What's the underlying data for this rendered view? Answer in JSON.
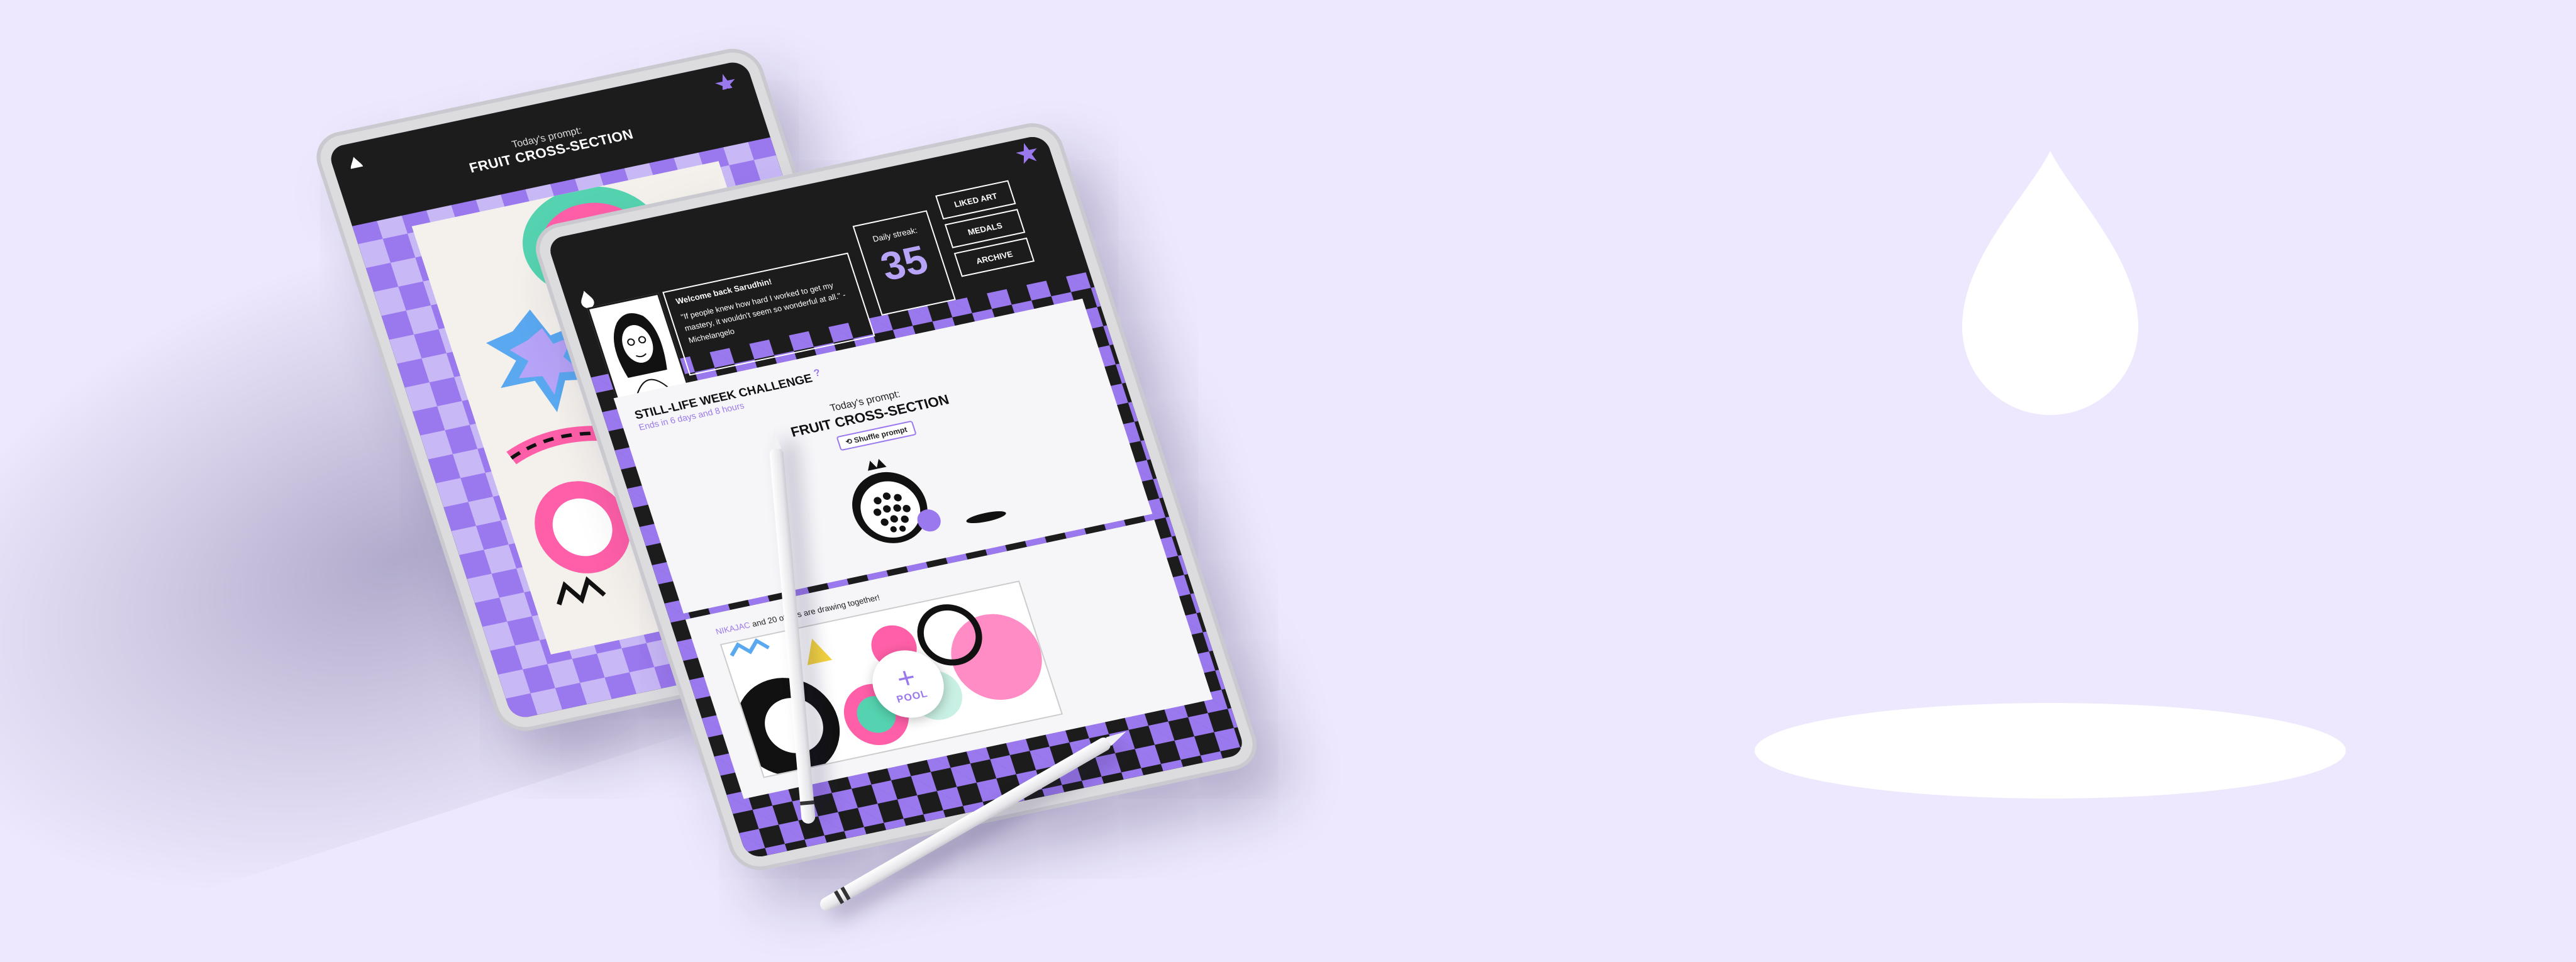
{
  "colors": {
    "background": "#ede8fd",
    "accent": "#9a78ee",
    "accent_light": "#c9b8f6",
    "dark": "#1c1c1c",
    "streak_number": "#b7a3f7"
  },
  "back_tablet": {
    "prompt_label": "Today's prompt:",
    "prompt_title": "FRUIT CROSS-SECTION",
    "icons": [
      "drop-icon",
      "star-icon"
    ]
  },
  "front_tablet": {
    "welcome": {
      "hello": "Welcome back Sarudhin!",
      "quote": "\"If people knew how hard I worked to get my mastery, it wouldn't seem so wonderful at all.\" - Michelangelo"
    },
    "streak": {
      "label": "Daily streak:",
      "value": "35"
    },
    "side_buttons": {
      "liked_art": "LIKED ART",
      "medals": "MEDALS",
      "archive": "ARCHIVE"
    },
    "challenge": {
      "title": "STILL-LIFE WEEK CHALLENGE",
      "help": "?",
      "ends_in": "Ends in 6 days and 8 hours"
    },
    "prompt": {
      "label": "Today's prompt:",
      "title": "FRUIT CROSS-SECTION",
      "shuffle": "Shuffle prompt"
    },
    "pool": {
      "who": "NIKAJAC",
      "rest": " and 20 others are drawing together!",
      "button_plus": "+",
      "button_label": "POOL"
    },
    "icons": [
      "drop-icon",
      "star-icon",
      "avatar-portrait",
      "pomegranate-illustration"
    ]
  }
}
